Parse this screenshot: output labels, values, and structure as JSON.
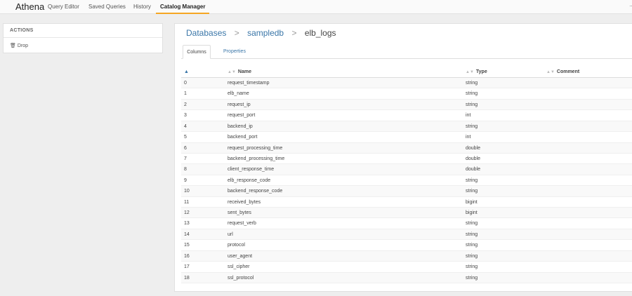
{
  "nav": {
    "brand": "Athena",
    "items": [
      {
        "label": "Query Editor"
      },
      {
        "label": "Saved Queries"
      },
      {
        "label": "History"
      },
      {
        "label": "Catalog Manager"
      }
    ],
    "overflow": "…"
  },
  "actions": {
    "title": "ACTIONS",
    "drop_label": "Drop"
  },
  "breadcrumb": {
    "databases": "Databases",
    "sep": ">",
    "database": "sampledb",
    "table": "elb_logs"
  },
  "tabs": {
    "columns": "Columns",
    "properties": "Properties"
  },
  "table": {
    "headers": {
      "name": "Name",
      "type": "Type",
      "comment": "Comment"
    },
    "rows": [
      {
        "idx": "0",
        "name": "request_timestamp",
        "type": "string"
      },
      {
        "idx": "1",
        "name": "elb_name",
        "type": "string"
      },
      {
        "idx": "2",
        "name": "request_ip",
        "type": "string"
      },
      {
        "idx": "3",
        "name": "request_port",
        "type": "int"
      },
      {
        "idx": "4",
        "name": "backend_ip",
        "type": "string"
      },
      {
        "idx": "5",
        "name": "backend_port",
        "type": "int"
      },
      {
        "idx": "6",
        "name": "request_processing_time",
        "type": "double"
      },
      {
        "idx": "7",
        "name": "backend_processing_time",
        "type": "double"
      },
      {
        "idx": "8",
        "name": "client_response_time",
        "type": "double"
      },
      {
        "idx": "9",
        "name": "elb_response_code",
        "type": "string"
      },
      {
        "idx": "10",
        "name": "backend_response_code",
        "type": "string"
      },
      {
        "idx": "11",
        "name": "received_bytes",
        "type": "bigint"
      },
      {
        "idx": "12",
        "name": "sent_bytes",
        "type": "bigint"
      },
      {
        "idx": "13",
        "name": "request_verb",
        "type": "string"
      },
      {
        "idx": "14",
        "name": "url",
        "type": "string"
      },
      {
        "idx": "15",
        "name": "protocol",
        "type": "string"
      },
      {
        "idx": "16",
        "name": "user_agent",
        "type": "string"
      },
      {
        "idx": "17",
        "name": "ssl_cipher",
        "type": "string"
      },
      {
        "idx": "18",
        "name": "ssl_protocol",
        "type": "string"
      }
    ]
  },
  "colors": {
    "accent": "#f5a623",
    "link": "#3a76a8"
  },
  "icons": {
    "drop": "trash-icon",
    "sort": "sort-icon",
    "sort_active": "sort-up-icon"
  }
}
